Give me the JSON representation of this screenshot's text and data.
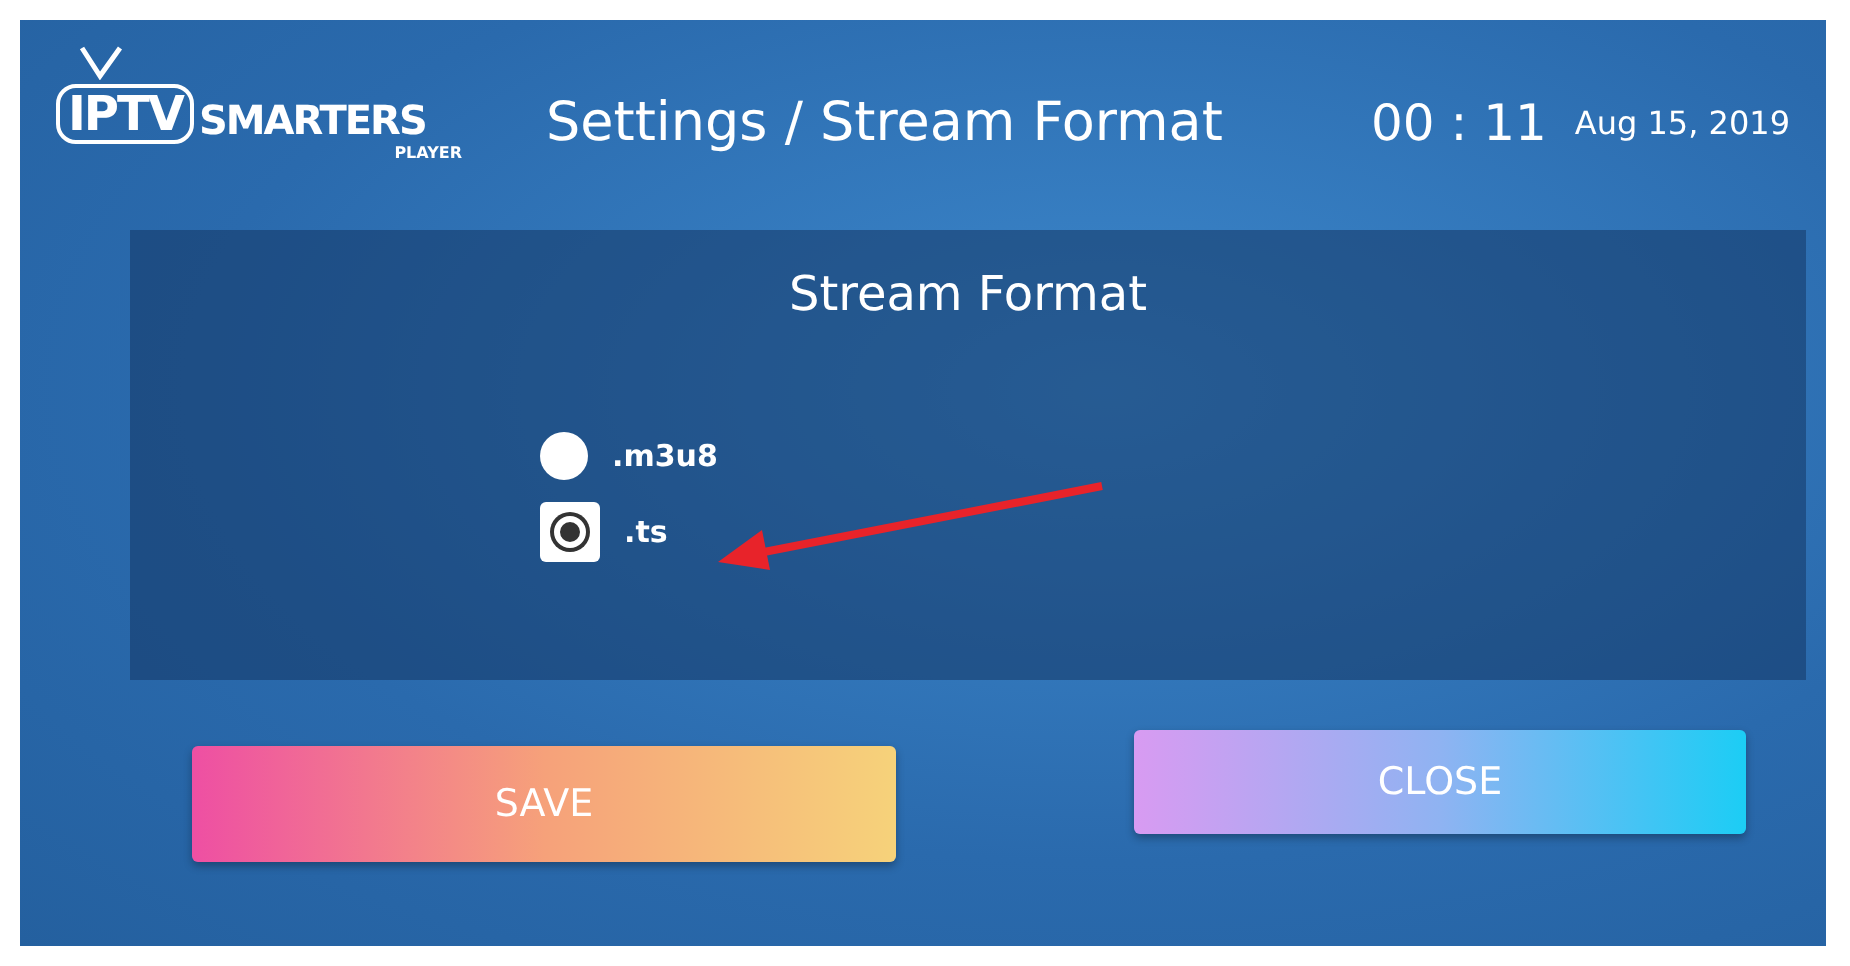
{
  "header": {
    "logo": {
      "brand": "IPTV",
      "name": "SMARTERS",
      "sub": "PLAYER"
    },
    "title": "Settings / Stream Format",
    "time": "00 : 11",
    "date": "Aug 15, 2019"
  },
  "panel": {
    "title": "Stream Format",
    "options": [
      {
        "label": ".m3u8",
        "selected": false
      },
      {
        "label": ".ts",
        "selected": true
      }
    ]
  },
  "buttons": [
    {
      "label": "SAVE",
      "kind": "save"
    },
    {
      "label": "CLOSE",
      "kind": "close"
    }
  ]
}
